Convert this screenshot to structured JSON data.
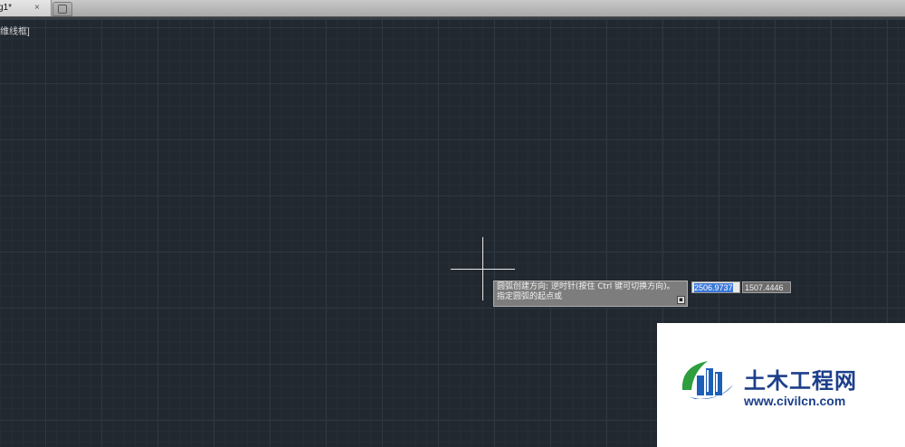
{
  "tabs": [
    {
      "label": "g1*",
      "close": "×"
    }
  ],
  "viewport": {
    "label": "维线框]"
  },
  "tooltip": {
    "line1": "圆弧创建方向: 逆时针(按住 Ctrl 键可切换方向)。",
    "line2": "指定圆弧的起点或",
    "more_icon": "▪"
  },
  "dynamic_input": {
    "x_value": "2506.9737",
    "y_value": "1507.4446"
  },
  "watermark": {
    "title": "土木工程网",
    "url": "www.civilcn.com"
  },
  "colors": {
    "canvas": "#212830",
    "grid_major": "#2f3842",
    "crosshair": "#e8e8e8",
    "tooltip_bg": "#7d7d7d",
    "selection": "#3b78d8",
    "watermark_text": "#1c3f8a"
  }
}
